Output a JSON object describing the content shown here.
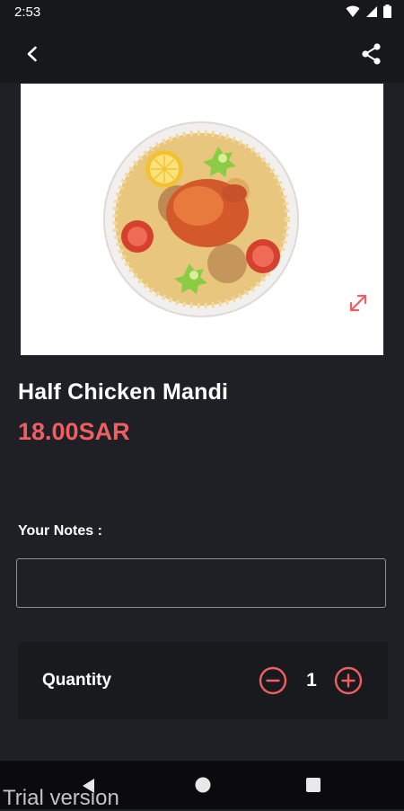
{
  "status_bar": {
    "time": "2:53"
  },
  "app_bar": {
    "back_icon": "arrow-back-icon",
    "share_icon": "share-icon"
  },
  "product": {
    "name": "Half Chicken Mandi",
    "price": "18.00SAR",
    "image_icon": "chicken-mandi-dish-image",
    "expand_icon": "expand-diagonal-icon"
  },
  "notes": {
    "label": "Your Notes :",
    "value": "",
    "placeholder": ""
  },
  "quantity": {
    "label": "Quantity",
    "value": "1",
    "minus_icon": "minus-circle-icon",
    "plus_icon": "plus-circle-icon"
  },
  "nav": {
    "back_icon": "triangle-back-icon",
    "home_icon": "circle-home-icon",
    "recent_icon": "square-recents-icon"
  },
  "watermark": "Trial version",
  "colors": {
    "accent": "#ef5f62",
    "background": "#1f2025",
    "appbar": "#17181c",
    "card": "#181a1e"
  }
}
